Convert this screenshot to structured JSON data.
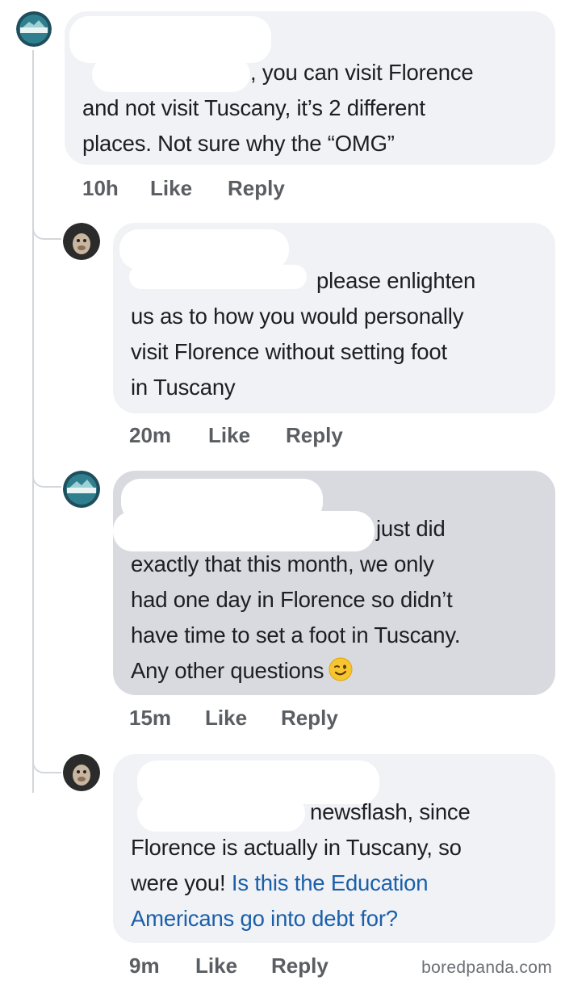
{
  "comments": [
    {
      "lines": [
        ", you can visit Florence",
        "and not visit Tuscany, it’s 2 different",
        "places. Not sure why the “OMG”"
      ],
      "time": "10h",
      "like": "Like",
      "reply": "Reply"
    },
    {
      "lines": [
        "please enlighten",
        "us as to how you would personally",
        "visit Florence without setting foot",
        "in Tuscany"
      ],
      "time": "20m",
      "like": "Like",
      "reply": "Reply"
    },
    {
      "lines": [
        "just did",
        "exactly that this month, we only",
        "had one day in Florence so didn’t",
        "have time to set a foot in Tuscany.",
        "Any other questions"
      ],
      "emoji": "winking-face-emoji",
      "time": "15m",
      "like": "Like",
      "reply": "Reply"
    },
    {
      "lines": [
        "newsflash, since",
        "Florence is actually in Tuscany, so",
        "were you!"
      ],
      "link_lines": [
        "Is this the Education",
        "Americans go into debt for?"
      ],
      "time": "9m",
      "like": "Like",
      "reply": "Reply"
    }
  ],
  "watermark": "boredpanda.com",
  "colors": {
    "bubble": "#f0f2f5",
    "bubble_highlighted": "#d8dadf",
    "link": "#1b5faa",
    "meta_text": "#5a5d62"
  }
}
